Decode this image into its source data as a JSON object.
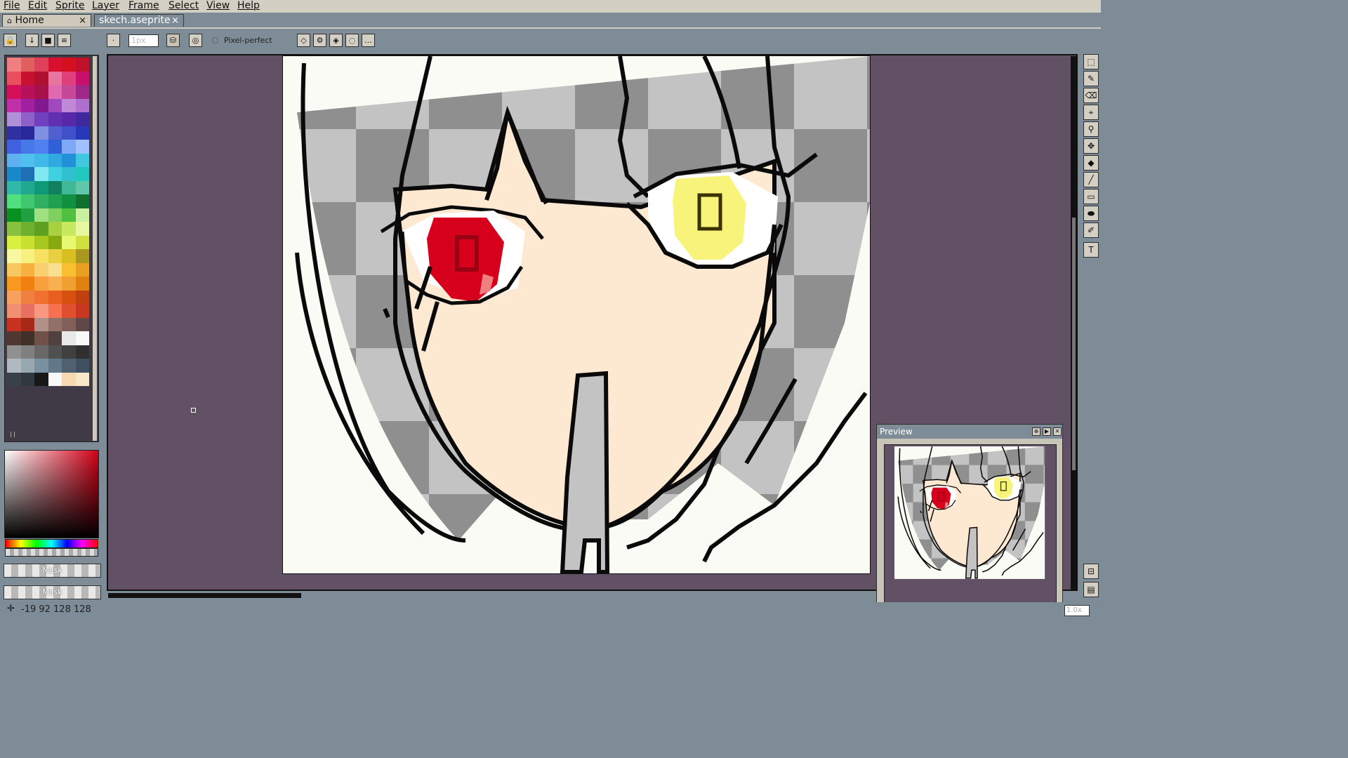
{
  "menu": {
    "file": "File",
    "edit": "Edit",
    "sprite": "Sprite",
    "layer": "Layer",
    "frame": "Frame",
    "select": "Select",
    "view": "View",
    "help": "Help"
  },
  "tabs": [
    {
      "label": "Home",
      "close": "×"
    },
    {
      "label": "skech.aseprite",
      "close": "×"
    }
  ],
  "toolbar": {
    "brush_size_placeholder": "1px",
    "pixel_perfect_label": "Pixel-perfect"
  },
  "palette": {
    "colors": [
      "#f08080",
      "#e06060",
      "#e0405a",
      "#d81030",
      "#d41020",
      "#c0102a",
      "#e85060",
      "#c81030",
      "#b01030",
      "#e874a0",
      "#e0407a",
      "#c8106a",
      "#d4105a",
      "#b8105a",
      "#a8104a",
      "#e06ab0",
      "#c84898",
      "#a02888",
      "#c030a8",
      "#a020a0",
      "#801890",
      "#a048c0",
      "#c088d8",
      "#b070d0",
      "#b090d8",
      "#9060c8",
      "#7040c0",
      "#6030b0",
      "#5828a8",
      "#4028a0",
      "#3030a0",
      "#28289a",
      "#8090e0",
      "#5060d0",
      "#4050c8",
      "#2838b8",
      "#4060e0",
      "#4878e8",
      "#5080f0",
      "#3060d8",
      "#80a8f8",
      "#a0c0ff",
      "#60b0f0",
      "#50c0f0",
      "#40b8e8",
      "#30a8e0",
      "#2090d8",
      "#40c8e0",
      "#1888c8",
      "#2070b8",
      "#80e8f0",
      "#40d0e0",
      "#30c0d0",
      "#20c8c0",
      "#30b8a8",
      "#20a890",
      "#109878",
      "#108060",
      "#40b898",
      "#60c8a8",
      "#50e080",
      "#40c870",
      "#30b060",
      "#20a050",
      "#109040",
      "#107030",
      "#089020",
      "#20a040",
      "#a0e080",
      "#80d060",
      "#50c040",
      "#c8f0a0",
      "#88c040",
      "#70b030",
      "#60a020",
      "#a8d040",
      "#c8e860",
      "#e8f8a0",
      "#d8f040",
      "#c8e030",
      "#a8c820",
      "#88a810",
      "#e8f870",
      "#d0e040",
      "#f8f8a0",
      "#f8f080",
      "#f8e060",
      "#e8d040",
      "#d8c020",
      "#a89820",
      "#f8c860",
      "#f8b040",
      "#f8d070",
      "#f8e090",
      "#f8c030",
      "#e8a020",
      "#f89820",
      "#f08010",
      "#f8a040",
      "#f8b050",
      "#f0a030",
      "#e08010",
      "#f8a060",
      "#f08040",
      "#f07030",
      "#e86020",
      "#d85010",
      "#c04010",
      "#f09070",
      "#e87060",
      "#f89880",
      "#f87050",
      "#e05030",
      "#c83820",
      "#c83020",
      "#a82818",
      "#b09088",
      "#907068",
      "#806058",
      "#604848",
      "#503830",
      "#403028",
      "#705048",
      "#504040",
      "#e8e8e8",
      "#f8f8f8",
      "#909090",
      "#808080",
      "#686868",
      "#505050",
      "#404040",
      "#303030",
      "#b0b8c0",
      "#98a8b0",
      "#7890a0",
      "#607888",
      "#506070",
      "#405060",
      "#384048",
      "#303840",
      "#181818",
      "#f8f8f8",
      "#f8d8b0",
      "#f8e8c8"
    ]
  },
  "color_bar": {
    "mask1": "Mask",
    "mask2": "Mask"
  },
  "canvas": {
    "colors": {
      "hair": "#fafbf5",
      "skin": "#fde9d2",
      "outline": "#0a0a0a",
      "red_eye": "#d6001c",
      "red_pupil": "#9a0014",
      "yellow_eye": "#f8f37a",
      "yellow_pupil": "#3a3200",
      "checker_light": "#c3c3c3",
      "checker_dark": "#8f8f8f",
      "workspace": "#625064",
      "highlight": "#f08080"
    }
  },
  "preview": {
    "title": "Preview"
  },
  "status": {
    "text": "-19 92   128 128",
    "zoom": "1.0x"
  }
}
